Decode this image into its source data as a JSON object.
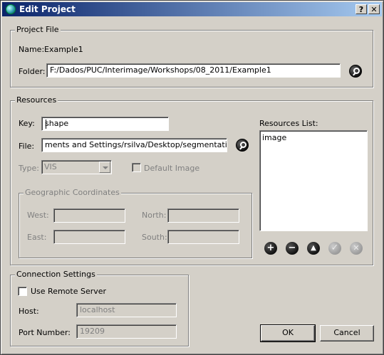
{
  "window": {
    "title": "Edit Project",
    "help_label": "?",
    "close_label": "✕"
  },
  "project_file": {
    "legend": "Project File",
    "name_label": "Name:",
    "name_value": "Example1",
    "folder_label": "Folder:",
    "folder_value": "F:/Dados/PUC/Interimage/Workshops/08_2011/Example1"
  },
  "resources": {
    "legend": "Resources",
    "key_label": "Key:",
    "key_value": "shape",
    "file_label": "File:",
    "file_value": "ments and Settings/rsilva/Desktop/segmentation.shp",
    "type_label": "Type:",
    "type_value": "VIS",
    "default_image_label": "Default Image",
    "list_label": "Resources List:",
    "list_items": [
      "image"
    ],
    "geo": {
      "legend": "Geographic Coordinates",
      "west_label": "West:",
      "north_label": "North:",
      "east_label": "East:",
      "south_label": "South:"
    },
    "list_buttons": {
      "add": "+",
      "remove": "−",
      "up": "▲",
      "apply": "✓",
      "cancel": "✕"
    }
  },
  "connection": {
    "legend": "Connection Settings",
    "use_remote_label": "Use Remote Server",
    "host_label": "Host:",
    "host_value": "localhost",
    "port_label": "Port Number:",
    "port_value": "19209"
  },
  "buttons": {
    "ok": "OK",
    "cancel": "Cancel"
  }
}
